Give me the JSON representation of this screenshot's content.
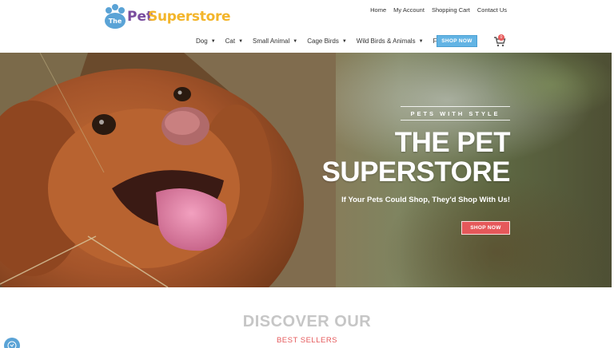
{
  "logo": {
    "the": "The",
    "pet": "Pet",
    "superstore": "Superstore"
  },
  "topnav": [
    "Home",
    "My Account",
    "Shopping Cart",
    "Contact Us"
  ],
  "mainnav": [
    "Dog",
    "Cat",
    "Small Animal",
    "Cage Birds",
    "Wild Birds & Animals",
    "Fish"
  ],
  "shop_now_top": "SHOP NOW",
  "cart_count": "0",
  "hero": {
    "tagline": "PETS WITH STYLE",
    "title_line1": "THE PET",
    "title_line2": "SUPERSTORE",
    "subtitle": "If Your Pets Could Shop, They'd Shop With Us!",
    "button": "SHOP NOW"
  },
  "section": {
    "heading": "DISCOVER OUR",
    "subheading": "BEST SELLERS"
  },
  "colors": {
    "accent_blue": "#63b4e4",
    "accent_red": "#e5585a",
    "logo_purple": "#7a4c9e",
    "logo_yellow": "#f3b52a"
  }
}
